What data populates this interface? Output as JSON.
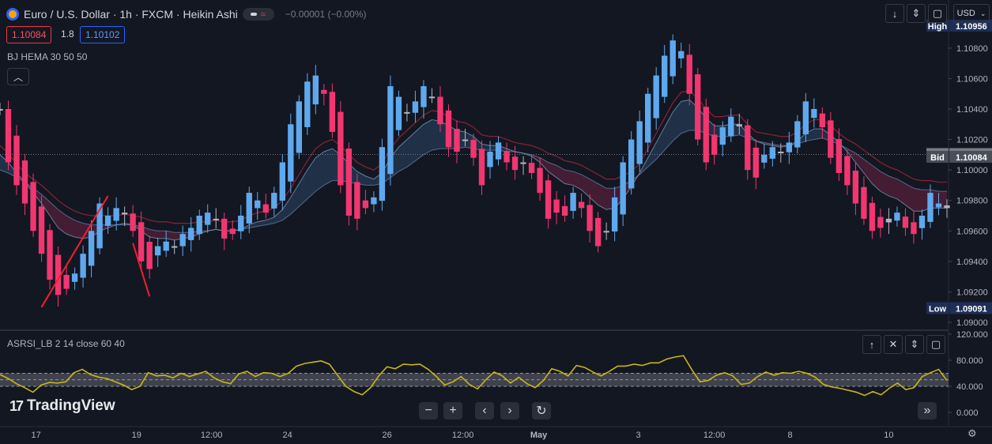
{
  "header": {
    "symbol_title": "Euro / U.S. Dollar · 1h · FXCM · Heikin Ashi",
    "change": "−0.00001 (−0.00%)",
    "bid": "1.10084",
    "spread": "1.8",
    "ask": "1.10102",
    "currency": "USD"
  },
  "indicators": {
    "main_label": "BJ HEMA 30 50 50",
    "sub_label": "ASRSI_LB 2 14 close 60 40"
  },
  "logo_text": "TradingView",
  "icons": {
    "toolbar": [
      "arrow-down-icon",
      "collapse-icon",
      "restore-icon"
    ],
    "pane": [
      "arrow-up-icon",
      "close-icon",
      "collapse-icon",
      "restore-icon"
    ],
    "nav": [
      "zoom-out-icon",
      "zoom-in-icon",
      "scroll-left-icon",
      "scroll-right-icon",
      "reset-icon",
      "go-to-latest-icon"
    ]
  },
  "colors": {
    "background": "#131722",
    "bull": "#5ea9ee",
    "bear": "#f23670",
    "neutral": "#b2b5be",
    "rsi_line": "#c9b515",
    "trend_line": "#f21f2f",
    "high_label": "#1e2e57",
    "low_label": "#1e2e57",
    "ask_label": "#787b86",
    "bid_label": "#4a4e59"
  },
  "chart_data": [
    {
      "type": "candlestick",
      "variant": "Heikin Ashi",
      "ylim": [
        1.09,
        1.1096
      ],
      "y_ticks": [
        "1.09000",
        "1.09200",
        "1.09400",
        "1.09600",
        "1.09800",
        "1.10000",
        "1.10200",
        "1.10400",
        "1.10600",
        "1.10800"
      ],
      "x_ticks": [
        "17",
        "19",
        "12:00",
        "24",
        "26",
        "12:00",
        "May",
        "3",
        "12:00",
        "8",
        "10"
      ],
      "x_tick_positions": [
        0.038,
        0.144,
        0.223,
        0.303,
        0.408,
        0.488,
        0.568,
        0.673,
        0.753,
        0.833,
        0.937
      ],
      "price_labels": [
        {
          "name": "High",
          "value": "1.10956"
        },
        {
          "name": "Ask",
          "value": "1.10102"
        },
        {
          "name": "Bid",
          "value": "1.10084"
        },
        {
          "name": "Low",
          "value": "1.09091"
        }
      ],
      "ask_line": 1.10102,
      "close_series": [
        1.104,
        1.1005,
        1.099,
        1.0978,
        1.096,
        1.0945,
        1.0928,
        1.0918,
        1.0922,
        1.0932,
        1.0945,
        1.096,
        1.0978,
        1.097,
        1.0975,
        1.0972,
        1.096,
        1.094,
        1.0935,
        1.095,
        1.0953,
        1.095,
        1.0958,
        1.0962,
        1.097,
        1.0972,
        1.0968,
        1.0955,
        1.0958,
        1.097,
        1.0985,
        1.098,
        1.0972,
        1.0985,
        1.1005,
        1.103,
        1.1045,
        1.1058,
        1.1062,
        1.105,
        1.1025,
        1.099,
        1.097,
        1.0968,
        1.0975,
        1.0982,
        1.1015,
        1.1055,
        1.1048,
        1.1038,
        1.1045,
        1.1055,
        1.1048,
        1.103,
        1.1015,
        1.1012,
        1.102,
        1.1008,
        1.099,
        1.1012,
        1.1018,
        1.1005,
        1.1,
        1.1005,
        1.0998,
        1.0985,
        1.0968,
        1.0972,
        1.097,
        1.0985,
        1.0975,
        1.096,
        1.095,
        1.096,
        1.0982,
        1.1005,
        1.102,
        1.1032,
        1.105,
        1.1062,
        1.1075,
        1.1085,
        1.1078,
        1.105,
        1.102,
        1.1005,
        1.101,
        1.1028,
        1.1035,
        1.103,
        1.1,
        1.0995,
        1.101,
        1.1015,
        1.1012,
        1.1018,
        1.1032,
        1.1045,
        1.104,
        1.1028,
        1.1008,
        1.0998,
        1.099,
        1.0978,
        1.0968,
        1.096,
        1.0962,
        1.0968,
        1.0972,
        1.0962,
        1.0958,
        1.097,
        1.0985,
        1.0978,
        1.0975
      ],
      "ema_fast": [
        1.101,
        1.1005,
        1.0998,
        1.0992,
        1.0985,
        1.0978,
        1.097,
        1.0962,
        1.0958,
        1.0956,
        1.0955,
        1.0956,
        1.096,
        1.0962,
        1.0964,
        1.0965,
        1.0964,
        1.096,
        1.0956,
        1.0955,
        1.0955,
        1.0954,
        1.0955,
        1.0956,
        1.0958,
        1.096,
        1.0961,
        1.096,
        1.096,
        1.0961,
        1.0964,
        1.0966,
        1.0967,
        1.0969,
        1.0974,
        1.0982,
        1.0991,
        1.1,
        1.1008,
        1.1012,
        1.1014,
        1.101,
        1.1004,
        1.0999,
        1.0996,
        1.0994,
        1.0998,
        1.1008,
        1.1015,
        1.102,
        1.1025,
        1.103,
        1.1033,
        1.1032,
        1.1029,
        1.1026,
        1.1025,
        1.1022,
        1.1017,
        1.1016,
        1.1016,
        1.1014,
        1.1012,
        1.1011,
        1.1009,
        1.1005,
        1.0999,
        1.0995,
        1.0991,
        1.099,
        1.0987,
        1.0982,
        1.0977,
        1.0974,
        1.0975,
        1.0981,
        1.0989,
        1.0998,
        1.1008,
        1.1018,
        1.1028,
        1.1038,
        1.1045,
        1.1046,
        1.1041,
        1.1034,
        1.1029,
        1.1029,
        1.103,
        1.103,
        1.1024,
        1.1019,
        1.1017,
        1.1016,
        1.1015,
        1.1016,
        1.1019,
        1.1024,
        1.1027,
        1.1027,
        1.1023,
        1.1018,
        1.1012,
        1.1005,
        1.0998,
        1.0991,
        1.0986,
        1.0983,
        1.0981,
        1.0977,
        1.0973,
        1.0973,
        1.0975,
        1.0975,
        1.0975
      ],
      "ema_slow": [
        1.1,
        1.0998,
        1.0995,
        1.0992,
        1.0988,
        1.0984,
        1.0979,
        1.0974,
        1.097,
        1.0967,
        1.0965,
        1.0964,
        1.0964,
        1.0964,
        1.0964,
        1.0964,
        1.0964,
        1.0963,
        1.0961,
        1.096,
        1.096,
        1.0959,
        1.0959,
        1.0959,
        1.096,
        1.096,
        1.0961,
        1.096,
        1.096,
        1.0961,
        1.0962,
        1.0963,
        1.0964,
        1.0965,
        1.0967,
        1.0971,
        1.0976,
        1.0981,
        1.0986,
        1.099,
        1.0993,
        1.0993,
        1.0992,
        1.0991,
        1.099,
        1.099,
        1.0991,
        1.0995,
        1.0999,
        1.1002,
        1.1006,
        1.101,
        1.1013,
        1.1014,
        1.1014,
        1.1014,
        1.1015,
        1.1014,
        1.1013,
        1.1013,
        1.1013,
        1.1012,
        1.1012,
        1.1011,
        1.101,
        1.1008,
        1.1005,
        1.1003,
        1.1,
        1.0999,
        1.0997,
        1.0994,
        1.0991,
        1.0988,
        1.0988,
        1.099,
        1.0993,
        1.0997,
        1.1002,
        1.1007,
        1.1013,
        1.1019,
        1.1024,
        1.1026,
        1.1026,
        1.1024,
        1.1022,
        1.1022,
        1.1022,
        1.1023,
        1.1021,
        1.1019,
        1.1018,
        1.1017,
        1.1016,
        1.1016,
        1.1017,
        1.1019,
        1.102,
        1.1021,
        1.1019,
        1.1017,
        1.1014,
        1.1011,
        1.1007,
        1.1003,
        1.0999,
        1.0996,
        1.0994,
        1.0991,
        1.0988,
        1.0987,
        1.0987,
        1.0986,
        1.0986
      ],
      "trend_lines": [
        {
          "from": [
            5,
            1.091
          ],
          "to": [
            13,
            1.0983
          ]
        },
        {
          "from": [
            16,
            1.0952
          ],
          "to": [
            18,
            1.0917
          ]
        }
      ]
    },
    {
      "type": "line",
      "title": "ASRSI_LB 2 14 close 60 40",
      "ylim": [
        0,
        120
      ],
      "y_ticks": [
        "0.000",
        "40.000",
        "80.000",
        "120.000"
      ],
      "band": [
        40,
        60
      ],
      "midline": 50,
      "values": [
        58,
        52,
        44,
        38,
        31,
        42,
        46,
        45,
        47,
        61,
        66,
        58,
        54,
        52,
        47,
        42,
        35,
        40,
        61,
        56,
        57,
        53,
        60,
        55,
        59,
        63,
        53,
        47,
        44,
        59,
        63,
        55,
        61,
        60,
        55,
        60,
        71,
        75,
        77,
        79,
        74,
        57,
        40,
        32,
        27,
        38,
        56,
        70,
        67,
        74,
        73,
        74,
        66,
        55,
        42,
        47,
        55,
        43,
        36,
        50,
        62,
        56,
        45,
        54,
        44,
        38,
        49,
        67,
        63,
        56,
        72,
        69,
        62,
        56,
        63,
        71,
        71,
        74,
        72,
        76,
        76,
        82,
        85,
        87,
        66,
        47,
        49,
        57,
        61,
        56,
        43,
        45,
        55,
        62,
        57,
        61,
        60,
        63,
        60,
        54,
        43,
        39,
        37,
        34,
        31,
        26,
        32,
        27,
        37,
        45,
        35,
        38,
        55,
        61,
        66,
        49
      ]
    }
  ]
}
